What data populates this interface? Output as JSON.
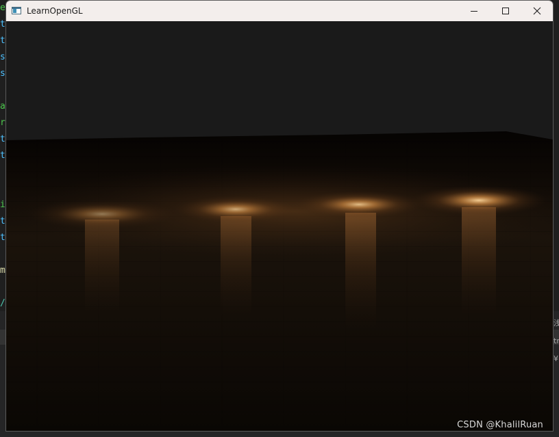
{
  "window": {
    "title": "LearnOpenGL",
    "minimize_icon": "minimize-icon",
    "maximize_icon": "maximize-icon",
    "close_icon": "close-icon",
    "app_icon": "opengl-window-icon"
  },
  "scene": {
    "clear_color": "#1a1a1a",
    "light_color": "#ffb45a",
    "floor_color": "#3a2614"
  },
  "watermark": {
    "text": "CSDN @KhalilRuan"
  },
  "background": {
    "code_fragments": [
      "e",
      "t",
      "t",
      "s",
      "s",
      "",
      "a",
      "r",
      "t",
      "t",
      "",
      "",
      "i",
      "t",
      "t",
      "",
      "m",
      "",
      "/"
    ],
    "code_colors": [
      "#4ec94e",
      "#4fc1ff",
      "#4fc1ff",
      "#4fc1ff",
      "#4fc1ff",
      "#4fc1ff",
      "#4ec94e",
      "#4ec94e",
      "#4fc1ff",
      "#4fc1ff",
      "#4fc1ff",
      "#4fc1ff",
      "#4ec94e",
      "#4fc1ff",
      "#4fc1ff",
      "#4fc1ff",
      "#dcdcaa",
      "#dcdcaa",
      "#4ec9b0"
    ],
    "right_fragments": [
      "浅",
      "tr",
      "¥"
    ]
  }
}
